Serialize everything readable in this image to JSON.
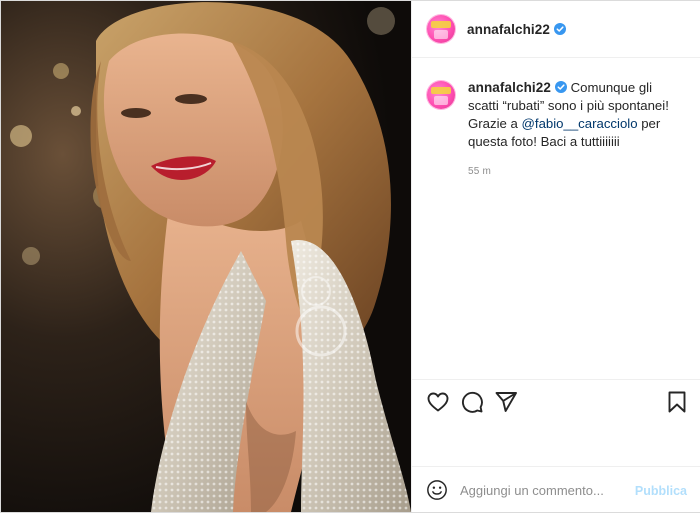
{
  "post": {
    "username": "annafalchi22",
    "verified": true,
    "image_icon": "photo-woman-sequin-dress"
  },
  "caption": {
    "username": "annafalchi22",
    "text_part1": " Comunque gli scatti “rubati” sono i più spontanei! Grazie a ",
    "mention": "@fabio__caracciolo",
    "text_part2": " per questa foto! Baci a tuttiiiiiii",
    "time": "55 m"
  },
  "actions": {
    "like_icon": "heart-icon",
    "comment_icon": "comment-icon",
    "share_icon": "paper-plane-icon",
    "save_icon": "bookmark-icon"
  },
  "comment": {
    "placeholder": "Aggiungi un commento...",
    "publish_label": "Pubblica",
    "emoji_icon": "smiley-icon"
  },
  "colors": {
    "verified_badge": "#3897f0",
    "mention": "#00376b",
    "publish_disabled": "#b2dffc",
    "muted_text": "#8e8e8e"
  }
}
